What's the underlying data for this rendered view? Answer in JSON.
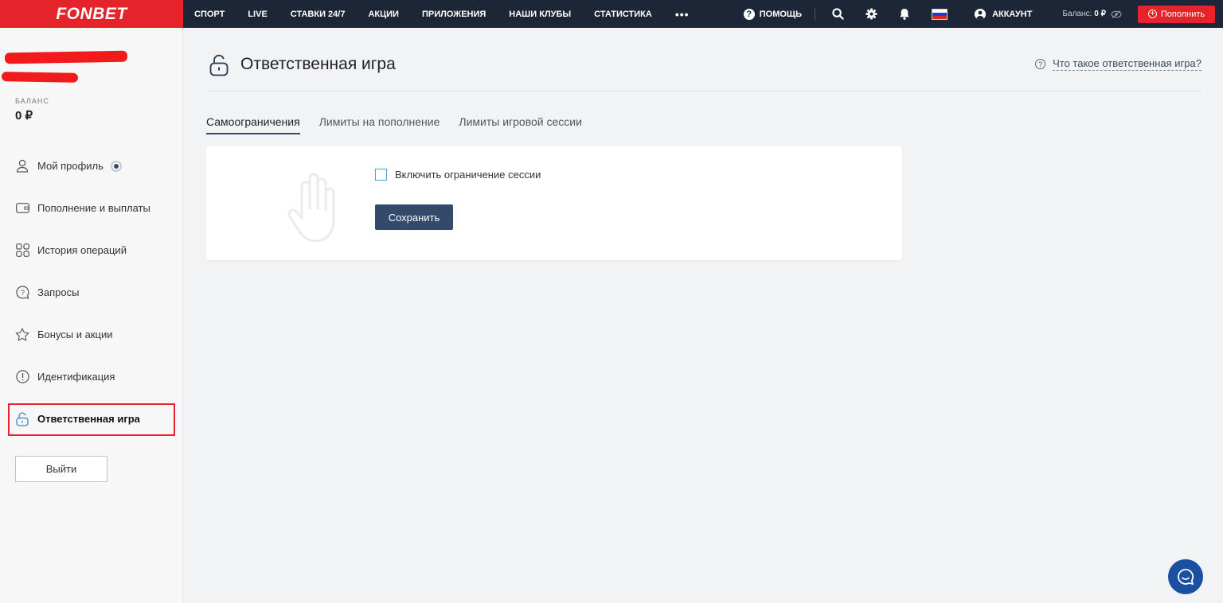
{
  "brand": {
    "logo": "FONBET",
    "color": "#e4232a",
    "dark": "#1d2636",
    "accent": "#334a6b"
  },
  "topnav": {
    "items": [
      "СПОРТ",
      "LIVE",
      "СТАВКИ 24/7",
      "АКЦИИ",
      "ПРИЛОЖЕНИЯ",
      "НАШИ КЛУБЫ",
      "СТАТИСТИКА"
    ],
    "more": "•••",
    "help": "ПОМОЩЬ",
    "account": "АККАУНТ",
    "balance_label": "Баланс:",
    "balance_value": "0 ₽",
    "topup": "Пополнить",
    "icons": [
      "question-circle-icon",
      "search-icon",
      "gear-icon",
      "bell-icon",
      "russia-flag-icon",
      "user-circle-icon",
      "eye-off-icon",
      "plus-circle-icon"
    ]
  },
  "sidebar": {
    "balance_label": "БАЛАНС",
    "balance_value": "0 ₽",
    "items": [
      {
        "label": "Мой профиль",
        "icon": "user-icon"
      },
      {
        "label": "Пополнение и выплаты",
        "icon": "wallet-icon"
      },
      {
        "label": "История операций",
        "icon": "grid-icon"
      },
      {
        "label": "Запросы",
        "icon": "question-bubble-icon"
      },
      {
        "label": "Бонусы и акции",
        "icon": "star-icon"
      },
      {
        "label": "Идентификация",
        "icon": "exclamation-circle-icon"
      },
      {
        "label": "Ответственная игра",
        "icon": "lock-icon",
        "active": true
      }
    ],
    "logout": "Выйти"
  },
  "main": {
    "title": "Ответственная игра",
    "what_link": "Что такое ответственная игра?",
    "tabs": [
      "Самоограничения",
      "Лимиты на пополнение",
      "Лимиты игровой сессии"
    ],
    "active_tab": 0,
    "checkbox_label": "Включить ограничение сессии",
    "checkbox_checked": false,
    "save": "Сохранить"
  }
}
